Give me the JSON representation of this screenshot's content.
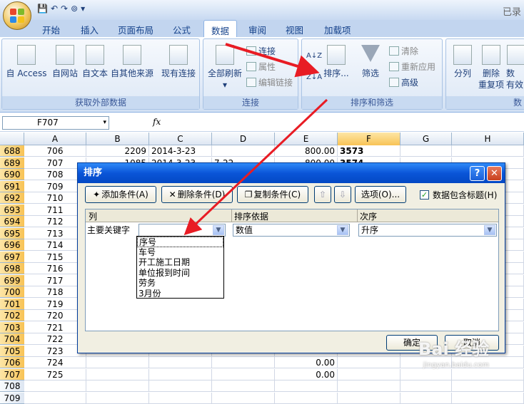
{
  "window": {
    "title_right": "已录"
  },
  "qat": [
    "💾",
    "↶",
    "↷",
    "⊚",
    "▾"
  ],
  "tabs": [
    "开始",
    "插入",
    "页面布局",
    "公式",
    "数据",
    "审阅",
    "视图",
    "加载项"
  ],
  "active_tab": "数据",
  "ribbon": {
    "get_external": {
      "label": "获取外部数据",
      "buttons": [
        "自 Access",
        "自网站",
        "自文本",
        "自其他来源",
        "现有连接"
      ]
    },
    "connections": {
      "label": "连接",
      "refresh_all": "全部刷新",
      "refresh_dd": "▾",
      "items": [
        "连接",
        "属性",
        "编辑链接"
      ]
    },
    "sort_filter": {
      "label": "排序和筛选",
      "az": "A↓Z",
      "za": "Z↓A",
      "sort": "排序...",
      "filter": "筛选",
      "items": [
        "清除",
        "重新应用",
        "高级"
      ]
    },
    "data_tools": {
      "label": "数",
      "split": "分列",
      "remove_dup_1": "删除",
      "remove_dup_2": "重复项",
      "valid_1": "数",
      "valid_2": "有效"
    }
  },
  "formula_bar": {
    "name_box": "F707",
    "dd": "▾",
    "fx": "fx"
  },
  "columns": [
    "A",
    "B",
    "C",
    "D",
    "E",
    "F",
    "G",
    "H"
  ],
  "rows": [
    {
      "n": "688",
      "a": "706",
      "b": "2209",
      "c": "2014-3-23",
      "d": "",
      "e": "800.00",
      "f": "3573"
    },
    {
      "n": "689",
      "a": "707",
      "b": "1085",
      "c": "2014-3-23",
      "d": "7-22",
      "e": "800.00",
      "f": "3574"
    },
    {
      "n": "690",
      "a": "708"
    },
    {
      "n": "691",
      "a": "709"
    },
    {
      "n": "692",
      "a": "710"
    },
    {
      "n": "693",
      "a": "711"
    },
    {
      "n": "694",
      "a": "712"
    },
    {
      "n": "695",
      "a": "713"
    },
    {
      "n": "696",
      "a": "714"
    },
    {
      "n": "697",
      "a": "715"
    },
    {
      "n": "698",
      "a": "716"
    },
    {
      "n": "699",
      "a": "717"
    },
    {
      "n": "700",
      "a": "718"
    },
    {
      "n": "701",
      "a": "719"
    },
    {
      "n": "702",
      "a": "720"
    },
    {
      "n": "703",
      "a": "721"
    },
    {
      "n": "704",
      "a": "722"
    },
    {
      "n": "705",
      "a": "723"
    },
    {
      "n": "706",
      "a": "724",
      "e": "0.00"
    },
    {
      "n": "707",
      "a": "725",
      "e": "0.00"
    },
    {
      "n": "708",
      "a": ""
    },
    {
      "n": "709",
      "a": ""
    }
  ],
  "dialog": {
    "title": "排序",
    "help": "?",
    "close": "✕",
    "add_level": "添加条件(A)",
    "delete_level": "删除条件(D)",
    "copy_level": "复制条件(C)",
    "up": "⇧",
    "down": "⇩",
    "options": "选项(O)...",
    "has_headers": "数据包含标题(H)",
    "checkmark": "✓",
    "col_header": "列",
    "sort_on_header": "排序依据",
    "order_header": "次序",
    "key_label": "主要关键字",
    "key_value": "",
    "sort_on_value": "数值",
    "order_value": "升序",
    "dropdown_items": [
      "序号",
      "车号",
      "开工施工日期",
      "单位报到时间",
      "劳务",
      "3月份"
    ],
    "ok": "确定",
    "cancel": "取消"
  },
  "watermark": {
    "brand": "Bai  经验",
    "url": "jingyan.baidu.com"
  },
  "colors": {
    "accent": "#0a55d8",
    "arrow": "#e81c24"
  }
}
